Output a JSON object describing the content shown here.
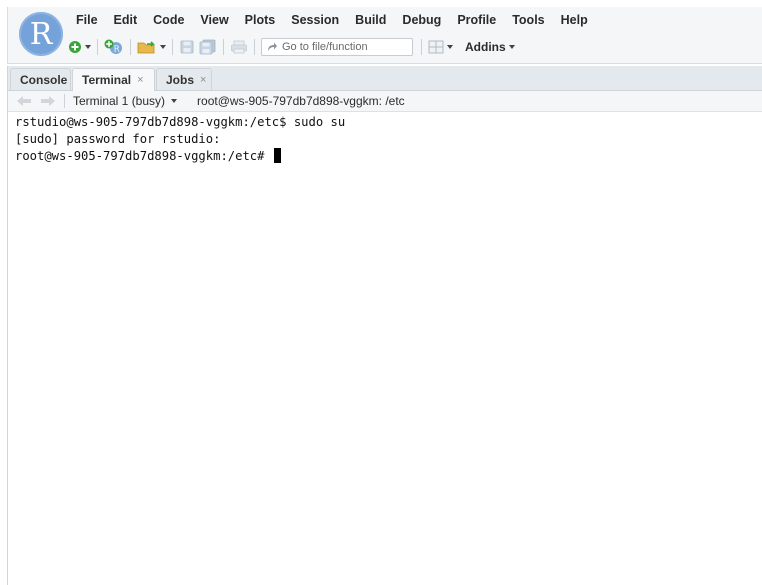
{
  "logo": {
    "letter": "R"
  },
  "menu": [
    "File",
    "Edit",
    "Code",
    "View",
    "Plots",
    "Session",
    "Build",
    "Debug",
    "Profile",
    "Tools",
    "Help"
  ],
  "toolbar": {
    "goto_placeholder": "Go to file/function",
    "addins_label": "Addins"
  },
  "tabs": [
    {
      "label": "Console",
      "closable": false
    },
    {
      "label": "Terminal",
      "closable": true
    },
    {
      "label": "Jobs",
      "closable": true
    }
  ],
  "tab_close_glyph": "×",
  "terminal_bar": {
    "selected_terminal": "Terminal 1 (busy)",
    "cwd": "root@ws-905-797db7d898-vggkm: /etc"
  },
  "terminal_lines": [
    "rstudio@ws-905-797db7d898-vggkm:/etc$ sudo su",
    "[sudo] password for rstudio:",
    "root@ws-905-797db7d898-vggkm:/etc# "
  ],
  "colors": {
    "logo": "#75a3d9",
    "toolbar_bg": "#f4f6f8",
    "tabstrip_bg": "#e4e9ee"
  }
}
